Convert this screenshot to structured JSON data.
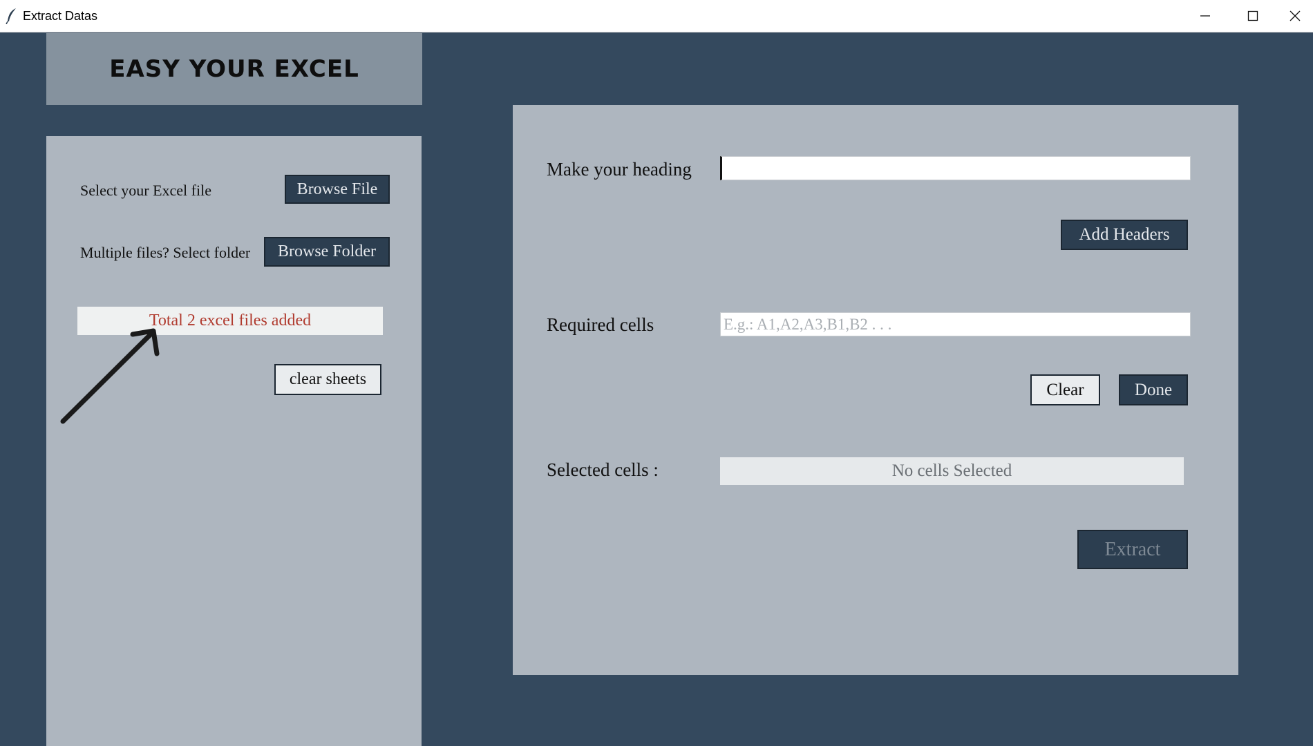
{
  "window": {
    "title": "Extract Datas",
    "icon": "feather-icon",
    "controls": [
      "minimize-icon",
      "maximize-icon",
      "close-icon"
    ]
  },
  "header": {
    "title": "EASY YOUR EXCEL"
  },
  "left_panel": {
    "select_file_label": "Select your Excel file",
    "browse_file_button": "Browse File",
    "select_folder_label": "Multiple files? Select folder",
    "browse_folder_button": "Browse Folder",
    "status_text": "Total 2 excel files added",
    "clear_sheets_button": "clear sheets"
  },
  "right_panel": {
    "heading_label": "Make your heading",
    "heading_value": "",
    "add_headers_button": "Add Headers",
    "required_cells_label": "Required cells",
    "required_cells_placeholder": "E.g.: A1,A2,A3,B1,B2 . . .",
    "clear_button": "Clear",
    "done_button": "Done",
    "selected_cells_label": "Selected cells :",
    "selected_cells_value": "No cells Selected",
    "extract_button": "Extract"
  },
  "colors": {
    "background": "#34495e",
    "panel": "#aeb6bf",
    "header_box": "#85929e",
    "button_dark": "#2c3e50",
    "status_text": "#b03a2e"
  }
}
